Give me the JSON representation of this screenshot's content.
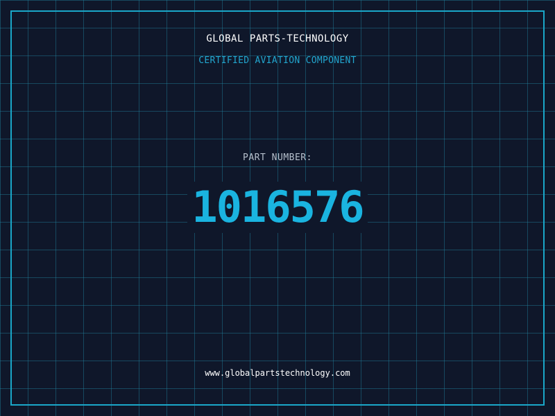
{
  "header": {
    "company": "GLOBAL PARTS-TECHNOLOGY",
    "subtitle": "CERTIFIED AVIATION COMPONENT"
  },
  "part": {
    "label": "PART NUMBER:",
    "number": "1016576"
  },
  "footer": {
    "url": "www.globalpartstechnology.com"
  },
  "colors": {
    "background": "#0f172a",
    "grid": "#2282a0",
    "accent": "#1ab4e0",
    "frame": "#1aa7c9",
    "label": "#b6c0cc",
    "text": "#ffffff"
  }
}
